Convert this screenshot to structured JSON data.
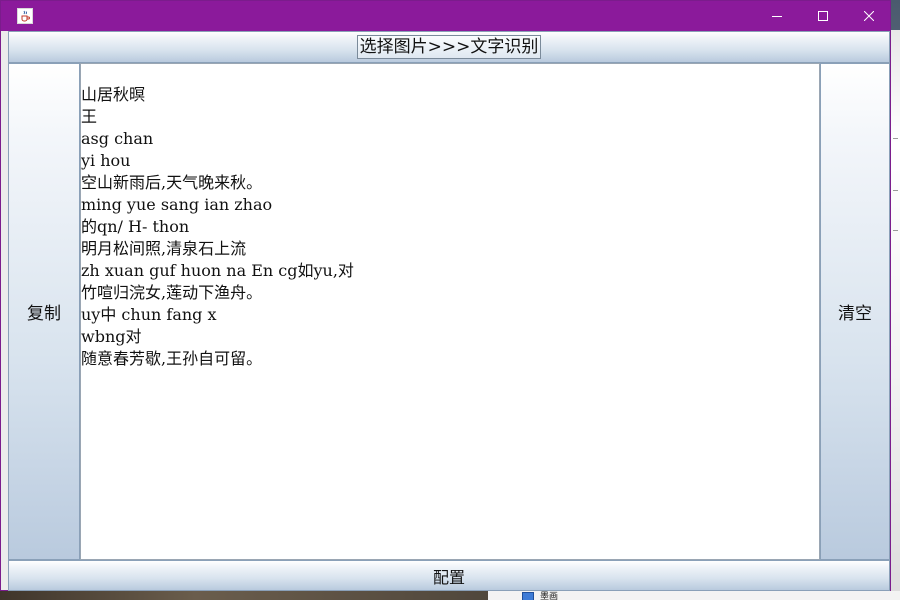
{
  "window": {
    "icon": "java-cup-icon",
    "controls": [
      "minimize-icon",
      "maximize-icon",
      "close-icon"
    ],
    "title_bar_color": "#8b1a9b"
  },
  "buttons": {
    "top": "选择图片>>>文字识别",
    "left": "复制",
    "right": "清空",
    "bottom": "配置"
  },
  "text_area": {
    "lines": [
      "山居秋暝",
      "王",
      "asg chan",
      "yi hou",
      "空山新雨后,天气晚来秋。",
      "ming yue sang ian zhao",
      "的qn/ H- thon",
      "明月松间照,清泉石上流",
      "zh xuan guf huon na En cg如yu,对",
      "竹喧归浣女,莲动下渔舟。",
      "uy中 chun fang x",
      "wbng对",
      "随意春芳歇,王孙自可留。"
    ]
  },
  "desktop": {
    "bottom_file_label": "墨画"
  }
}
